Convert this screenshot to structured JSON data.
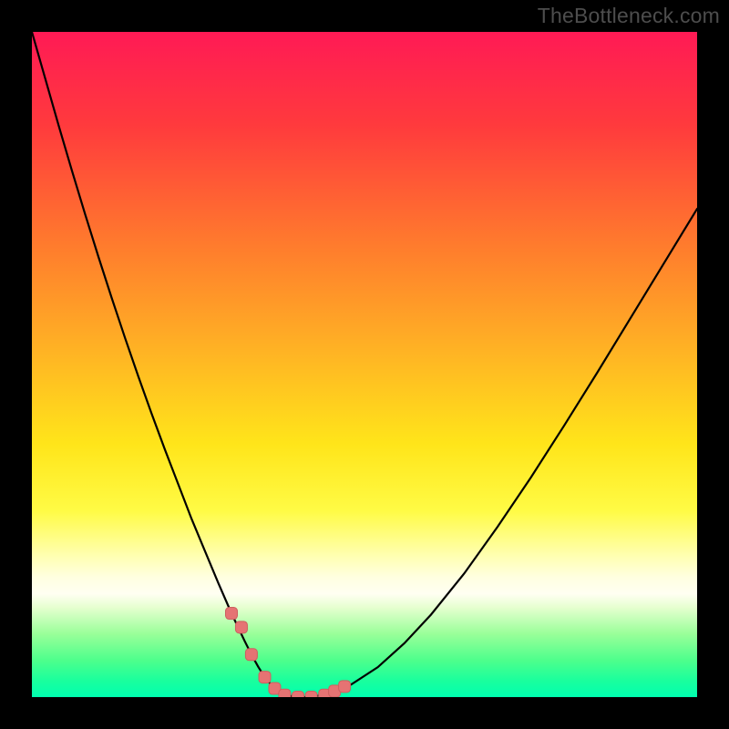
{
  "watermark": "TheBottleneck.com",
  "colors": {
    "frame": "#000000",
    "watermark": "#4d4d4d",
    "curve": "#000000",
    "markers_primary": "#e57373",
    "markers_border": "#cc6060",
    "gradient_stops": [
      {
        "offset": 0,
        "color": "#ff1a55"
      },
      {
        "offset": 0.14,
        "color": "#ff3a3d"
      },
      {
        "offset": 0.32,
        "color": "#ff7b2d"
      },
      {
        "offset": 0.48,
        "color": "#ffb324"
      },
      {
        "offset": 0.62,
        "color": "#ffe51a"
      },
      {
        "offset": 0.72,
        "color": "#fffb45"
      },
      {
        "offset": 0.79,
        "color": "#ffffb5"
      },
      {
        "offset": 0.82,
        "color": "#ffffe0"
      },
      {
        "offset": 0.845,
        "color": "#fffff2"
      },
      {
        "offset": 0.865,
        "color": "#e6ffd0"
      },
      {
        "offset": 0.905,
        "color": "#99ff99"
      },
      {
        "offset": 0.945,
        "color": "#4dff8c"
      },
      {
        "offset": 0.975,
        "color": "#1aff9d"
      },
      {
        "offset": 1.0,
        "color": "#00ffb0"
      }
    ]
  },
  "chart_data": {
    "type": "line",
    "title": "",
    "xlabel": "",
    "ylabel": "",
    "xlim": [
      0,
      100
    ],
    "ylim": [
      0,
      100
    ],
    "x": [
      0,
      2,
      4,
      6,
      8,
      10,
      12,
      14,
      16,
      18,
      20,
      22,
      24,
      26,
      28,
      30,
      32,
      33,
      34,
      35,
      36,
      37,
      38,
      40,
      42,
      45,
      48,
      52,
      56,
      60,
      65,
      70,
      75,
      80,
      85,
      90,
      95,
      100
    ],
    "y": [
      100,
      93,
      86,
      79.2,
      72.6,
      66.2,
      60,
      54,
      48.2,
      42.6,
      37.2,
      32,
      26.8,
      22,
      17.2,
      12.6,
      8.4,
      6.4,
      4.6,
      3.0,
      1.8,
      0.9,
      0.3,
      0,
      0,
      0.6,
      1.9,
      4.5,
      8.1,
      12.4,
      18.6,
      25.6,
      33.0,
      40.8,
      48.8,
      57.0,
      65.2,
      73.4
    ],
    "markers": {
      "x": [
        30,
        31.5,
        33,
        35,
        36.5,
        38,
        40,
        42,
        44,
        45.5,
        47
      ],
      "y": [
        12.6,
        10.5,
        6.4,
        3.0,
        1.3,
        0.3,
        0,
        0,
        0.3,
        0.9,
        1.6
      ]
    }
  }
}
